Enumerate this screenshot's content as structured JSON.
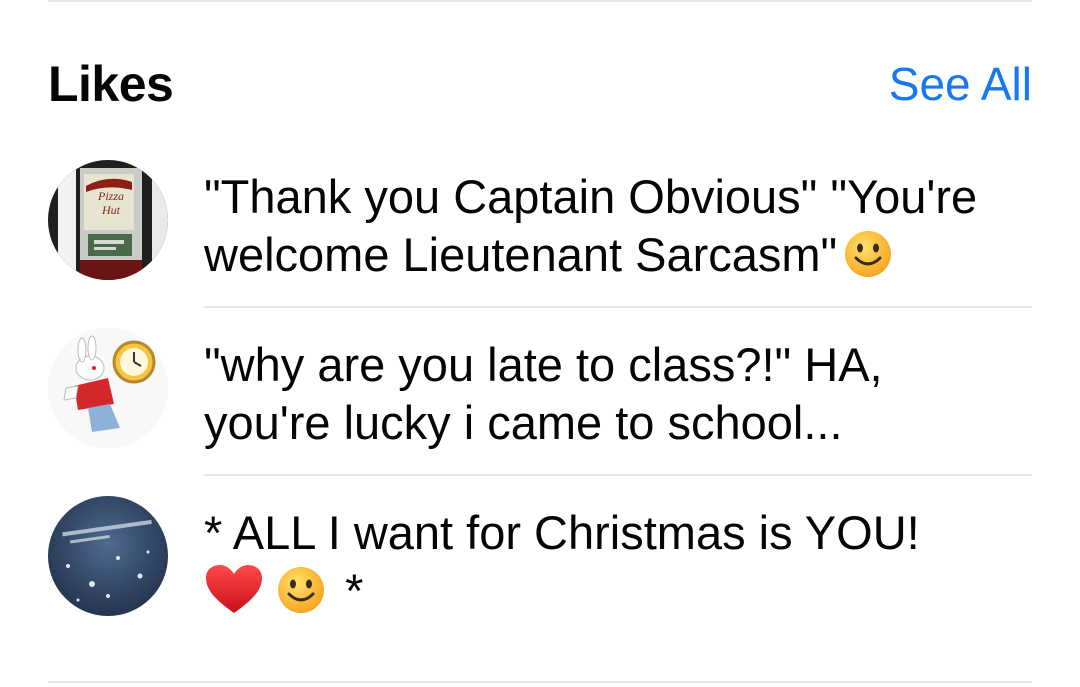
{
  "header": {
    "title": "Likes",
    "see_all_label": "See All"
  },
  "likes": [
    {
      "avatar_icon": "pizza-hut-sign-avatar",
      "line1": "\"Thank you Captain Obvious\" \"You're",
      "line2": "welcome Lieutenant Sarcasm\"",
      "line2_emoji": "smiley-face-icon"
    },
    {
      "avatar_icon": "white-rabbit-clock-avatar",
      "line1": "\"why are you late to class?!\" HA,",
      "line2": "you're lucky i came to school..."
    },
    {
      "avatar_icon": "christmas-snow-avatar",
      "line1": "* ALL I want for Christmas is YOU!",
      "line2_emojis": [
        "red-heart-icon",
        "smiley-face-icon"
      ],
      "line2_suffix": "*"
    }
  ],
  "colors": {
    "link": "#1877f2",
    "text": "#050505",
    "divider": "#e4e6eb"
  }
}
